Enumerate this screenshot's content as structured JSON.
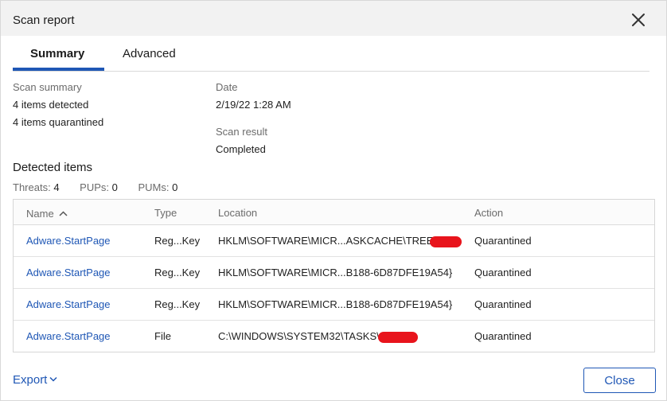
{
  "dialog": {
    "title": "Scan report"
  },
  "tabs": [
    {
      "label": "Summary",
      "active": true
    },
    {
      "label": "Advanced",
      "active": false
    }
  ],
  "summary": {
    "scan_summary_label": "Scan summary",
    "items_detected": "4 items detected",
    "items_quarantined": "4 items quarantined",
    "date_label": "Date",
    "date_value": "2/19/22 1:28 AM",
    "scan_result_label": "Scan result",
    "scan_result_value": "Completed"
  },
  "detected": {
    "title": "Detected items",
    "threats_label": "Threats:",
    "threats_value": "4",
    "pups_label": "PUPs:",
    "pups_value": "0",
    "pums_label": "PUMs:",
    "pums_value": "0"
  },
  "table": {
    "columns": {
      "name": "Name",
      "type": "Type",
      "location": "Location",
      "action": "Action"
    },
    "rows": [
      {
        "name": "Adware.StartPage",
        "type": "Reg...Key",
        "location": "HKLM\\SOFTWARE\\MICR...ASKCACHE\\TREE",
        "action": "Quarantined",
        "redacted": true
      },
      {
        "name": "Adware.StartPage",
        "type": "Reg...Key",
        "location": "HKLM\\SOFTWARE\\MICR...B188-6D87DFE19A54}",
        "action": "Quarantined",
        "redacted": false
      },
      {
        "name": "Adware.StartPage",
        "type": "Reg...Key",
        "location": "HKLM\\SOFTWARE\\MICR...B188-6D87DFE19A54}",
        "action": "Quarantined",
        "redacted": false
      },
      {
        "name": "Adware.StartPage",
        "type": "File",
        "location": "C:\\WINDOWS\\SYSTEM32\\TASKS\\",
        "action": "Quarantined",
        "redacted": true
      }
    ]
  },
  "footer": {
    "export_label": "Export",
    "close_label": "Close"
  },
  "colors": {
    "accent": "#1f57b5",
    "redaction": "#e8141c"
  },
  "icons": {
    "close": "close-icon",
    "sort": "sort-ascending-icon",
    "export_chevron": "chevron-down-icon"
  }
}
